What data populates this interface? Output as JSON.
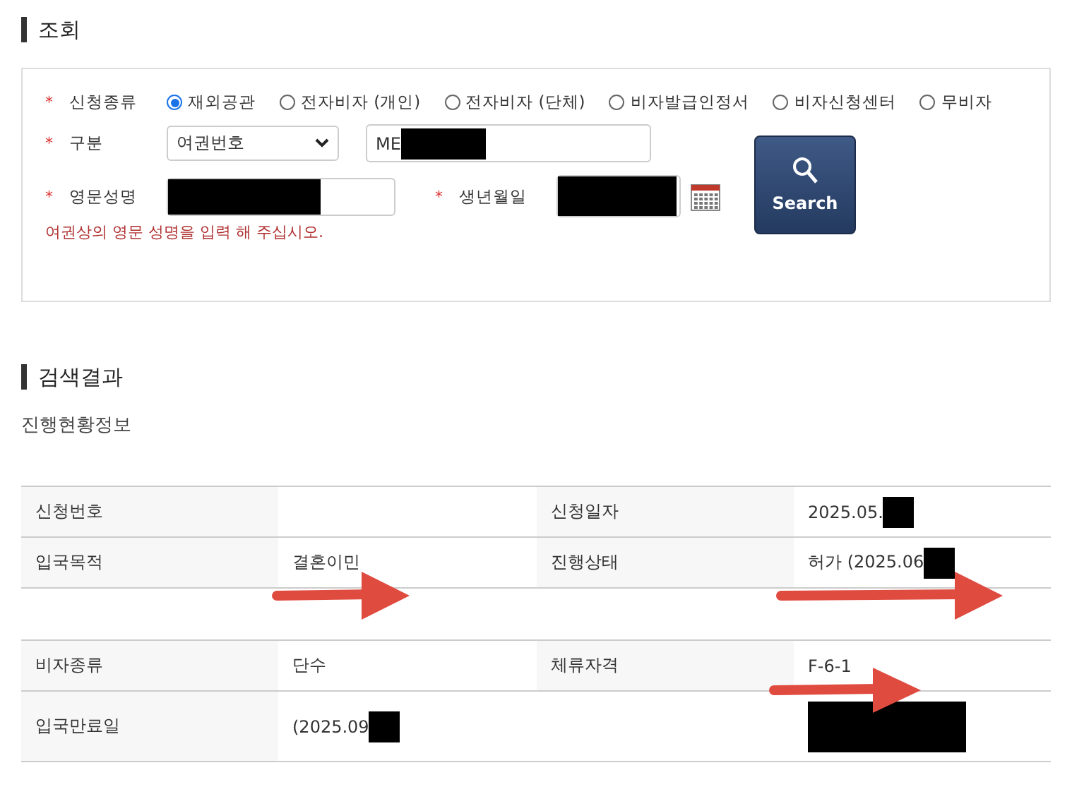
{
  "search_section": {
    "title": "조회",
    "application_type": {
      "mark": "*",
      "label": "신청종류",
      "options": [
        {
          "label": "재외공관",
          "selected": true
        },
        {
          "label": "전자비자 (개인)",
          "selected": false
        },
        {
          "label": "전자비자 (단체)",
          "selected": false
        },
        {
          "label": "비자발급인정서",
          "selected": false
        },
        {
          "label": "비자신청센터",
          "selected": false
        },
        {
          "label": "무비자",
          "selected": false
        }
      ]
    },
    "category": {
      "mark": "*",
      "label": "구분",
      "select_value": "여권번호",
      "value": "ME",
      "redacted": true
    },
    "english_name": {
      "mark": "*",
      "label": "영문성명",
      "redacted": true,
      "hint": "여권상의 영문 성명을 입력 해 주십시오."
    },
    "birth_date": {
      "mark": "*",
      "label": "생년월일",
      "redacted": true
    },
    "search_button": "Search"
  },
  "results_section": {
    "title": "검색결과",
    "subtitle": "진행현황정보",
    "table_1": {
      "rows": [
        {
          "cells": [
            {
              "kind": "label",
              "text": "신청번호"
            },
            {
              "kind": "value",
              "text": ""
            },
            {
              "kind": "label",
              "text": "신청일자"
            },
            {
              "kind": "value",
              "text": "2025.05.",
              "redacted": true
            }
          ]
        },
        {
          "cells": [
            {
              "kind": "label",
              "text": "입국목적"
            },
            {
              "kind": "value",
              "text": "결혼이민"
            },
            {
              "kind": "label",
              "text": "진행상태"
            },
            {
              "kind": "value",
              "text": "허가 (2025.06",
              "redacted": true
            }
          ]
        }
      ]
    },
    "table_2": {
      "rows": [
        {
          "cells": [
            {
              "kind": "label",
              "text": "비자종류"
            },
            {
              "kind": "value",
              "text": "단수"
            },
            {
              "kind": "label",
              "text": "체류자격"
            },
            {
              "kind": "value",
              "text": "F-6-1"
            }
          ]
        },
        {
          "cells": [
            {
              "kind": "label",
              "text": "입국만료일"
            },
            {
              "kind": "value",
              "text": "(2025.09",
              "redacted": true
            },
            {
              "kind": "value",
              "text": ""
            },
            {
              "kind": "value",
              "text": "",
              "redacted": true,
              "large": true
            }
          ]
        }
      ]
    }
  },
  "annotations": [
    {
      "kind": "arrow"
    },
    {
      "kind": "arrow"
    },
    {
      "kind": "arrow"
    }
  ]
}
